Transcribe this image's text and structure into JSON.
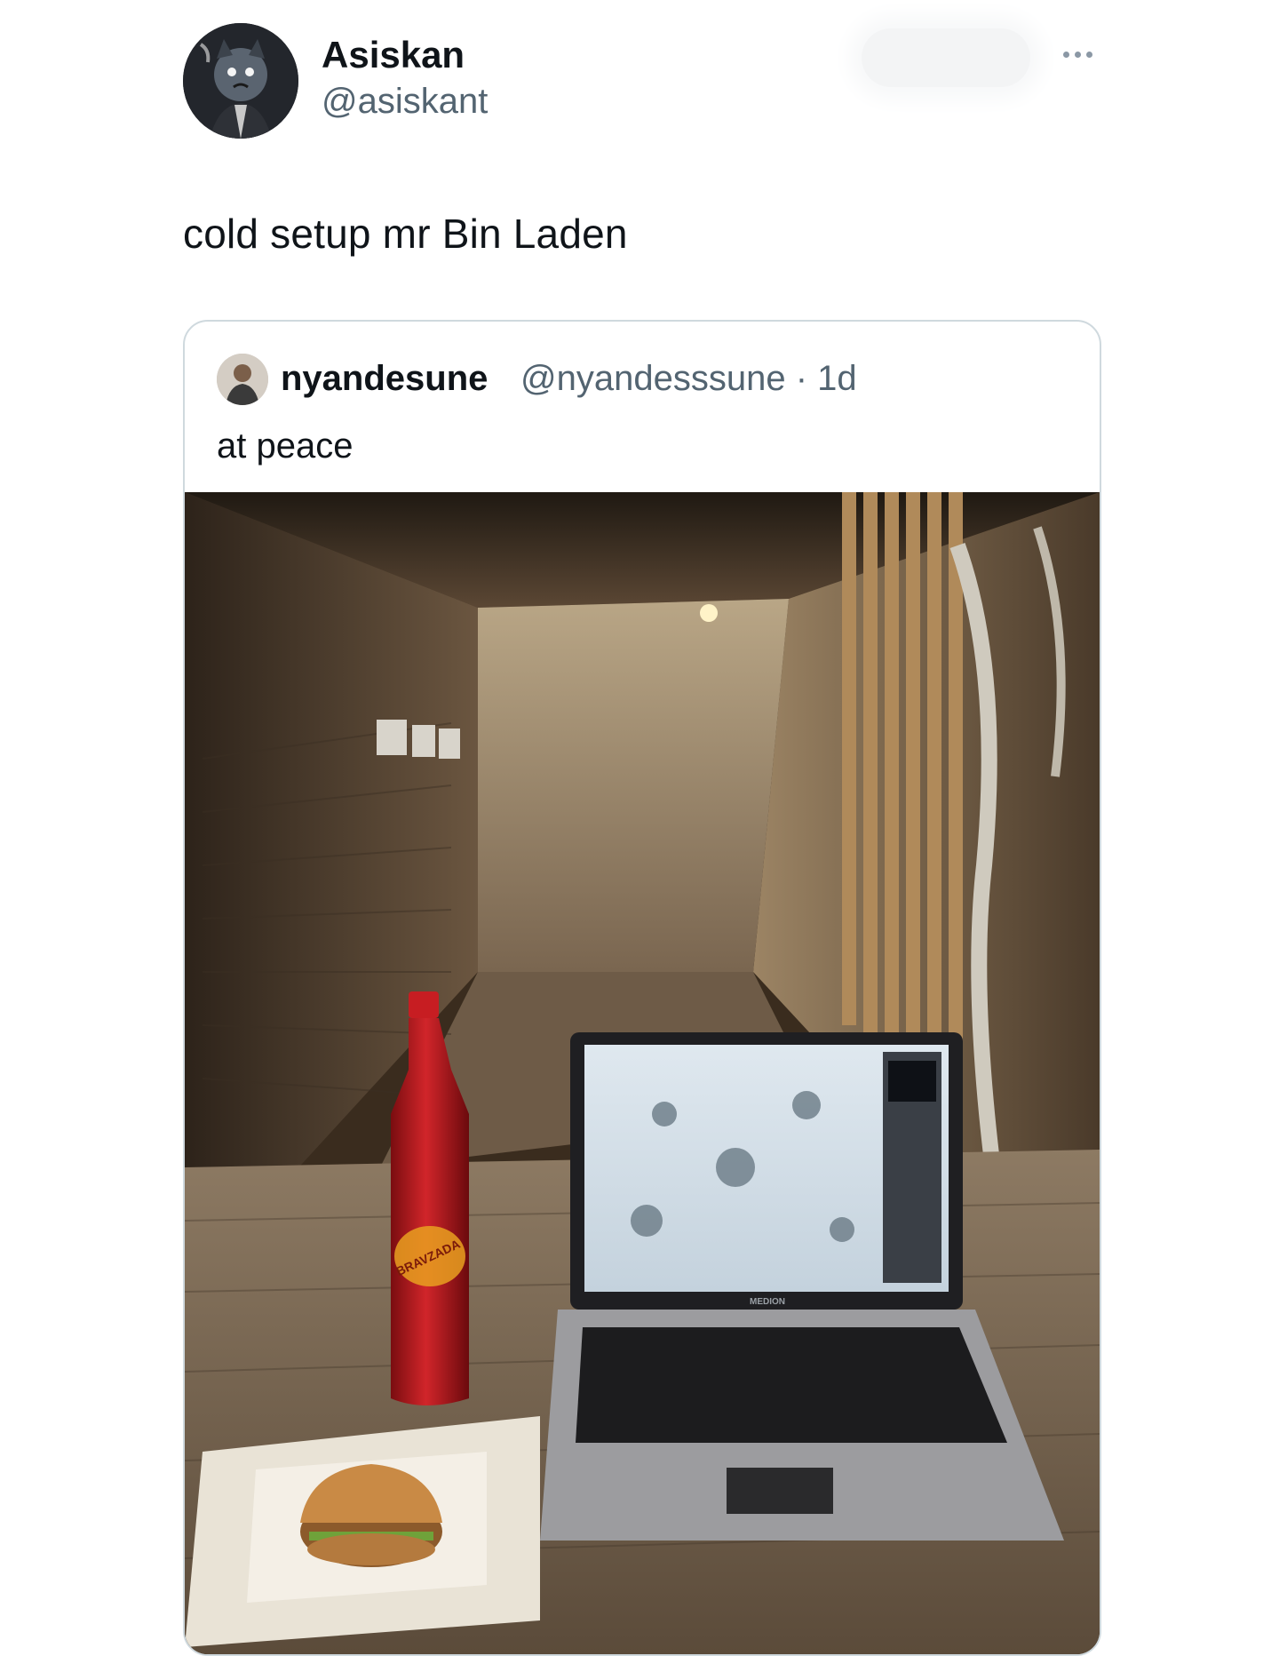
{
  "tweet": {
    "author": {
      "display_name": "Asiskan",
      "handle": "@asiskant"
    },
    "text": "cold setup mr Bin Laden",
    "more_icon": "more-horizontal-icon",
    "quoted_tweet": {
      "author": {
        "display_name": "nyandesune",
        "handle": "@nyandesssune"
      },
      "separator": "·",
      "time": "1d",
      "text": "at peace",
      "photo": {
        "bottle_label": "BRAVZADA",
        "laptop_brand": "MEDION"
      }
    }
  }
}
